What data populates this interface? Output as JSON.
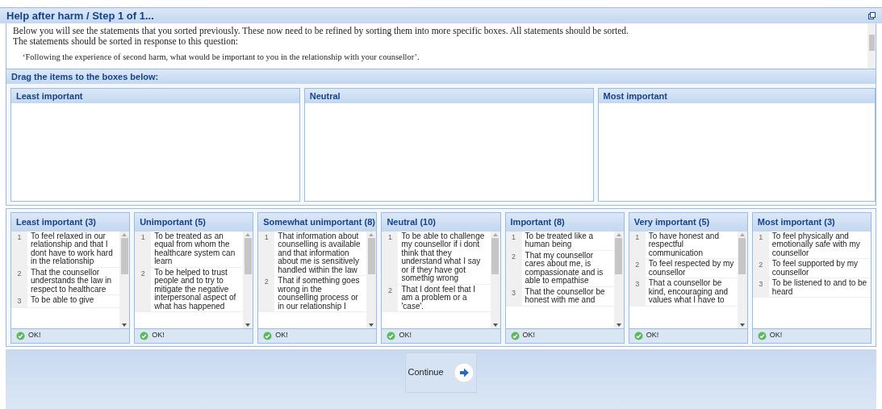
{
  "window": {
    "title": "Help after harm / Step 1 of 1..."
  },
  "intro": {
    "lines": [
      "Below you will see the statements that you sorted previously. These now need to be refined by sorting them into more specific boxes. All statements should be sorted.",
      "The statements should be sorted in response to this question:"
    ],
    "question": "‘Following the experience of second harm, what would be important to you in the relationship with your counsellor’."
  },
  "drag_header": "Drag the items to the boxes below:",
  "drop_boxes": [
    "Least important",
    "Neutral",
    "Most important"
  ],
  "columns": [
    {
      "title": "Least important (3)",
      "scrollable": true,
      "status": "OK!",
      "items": [
        {
          "n": "1",
          "text": "To feel relaxed in our relationship and that I dont have to work hard in the relationship"
        },
        {
          "n": "2",
          "text": "That the counsellor understands the law in respect to healthcare"
        },
        {
          "n": "3",
          "text": "To be able to give"
        }
      ]
    },
    {
      "title": "Unimportant (5)",
      "scrollable": true,
      "status": "OK!",
      "items": [
        {
          "n": "1",
          "text": "To be treated as an equal from whom the healthcare system can learn"
        },
        {
          "n": "2",
          "text": "To be helped to trust people and to try to mitigate the negative interpersonal aspect of what has happened"
        }
      ]
    },
    {
      "title": "Somewhat unimportant (8)",
      "scrollable": true,
      "status": "OK!",
      "items": [
        {
          "n": "1",
          "text": "That information about counselling is available and that information about me is sensitively handled within the law"
        },
        {
          "n": "2",
          "text": "That if something goes wrong in the counselling process or in our relationship I"
        }
      ]
    },
    {
      "title": "Neutral (10)",
      "scrollable": true,
      "status": "OK!",
      "items": [
        {
          "n": "1",
          "text": "To be able to challenge my counsellor if i dont think that they understand what I say or if they have got somethig wrong"
        },
        {
          "n": "2",
          "text": "That I dont feel that I am a problem or a 'case'."
        }
      ]
    },
    {
      "title": "Important (8)",
      "scrollable": true,
      "status": "OK!",
      "items": [
        {
          "n": "1",
          "text": "To be treated like a human being"
        },
        {
          "n": "2",
          "text": "That my counsellor cares about me, is compassionate and is able to empathise"
        },
        {
          "n": "3",
          "text": "That the counsellor be honest with me and"
        }
      ]
    },
    {
      "title": "Very important (5)",
      "scrollable": true,
      "status": "OK!",
      "items": [
        {
          "n": "1",
          "text": "To have honest and respectful communication"
        },
        {
          "n": "2",
          "text": "To feel respected by my counsellor"
        },
        {
          "n": "3",
          "text": "That a counsellor be kind, encouraging and values what I have to"
        }
      ]
    },
    {
      "title": "Most important (3)",
      "scrollable": false,
      "status": "OK!",
      "items": [
        {
          "n": "1",
          "text": "To feel physically and emotionally safe with my counsellor"
        },
        {
          "n": "2",
          "text": "To feel supported by my counsellor"
        },
        {
          "n": "3",
          "text": "To be listened to and to be heard"
        }
      ]
    }
  ],
  "continue_button": "Continue"
}
